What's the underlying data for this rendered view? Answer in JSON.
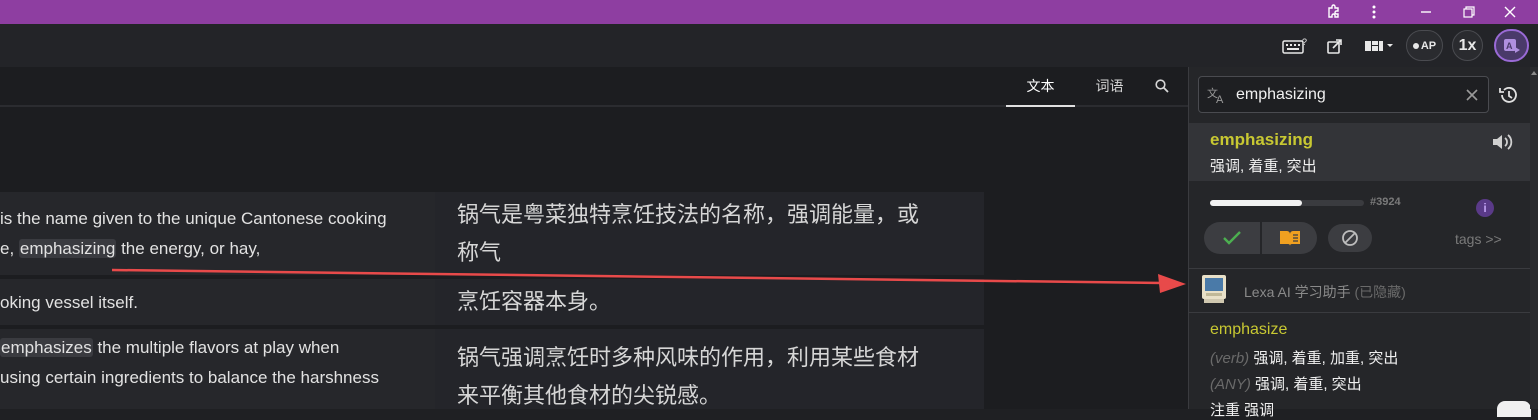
{
  "toolbar": {
    "ap_label": "AP",
    "speed_label": "1x"
  },
  "tabs": [
    {
      "label": "文本"
    },
    {
      "label": "词语"
    }
  ],
  "rows": [
    {
      "source_lines": [
        {
          "pre": " is the name given to the unique Cantonese cooking",
          "hl": "",
          "post": ""
        },
        {
          "pre": "e, ",
          "hl": "emphasizing",
          "post": " the energy, or hay,"
        }
      ],
      "target": "锅气是粤菜独特烹饪技法的名称，强调能量，或称气"
    },
    {
      "source_lines": [
        {
          "pre": "oking vessel itself.",
          "hl": "",
          "post": ""
        }
      ],
      "target": "烹饪容器本身。"
    },
    {
      "source_lines": [
        {
          "pre": " ",
          "hl": "emphasizes",
          "post": " the multiple flavors at play when"
        },
        {
          "pre": " using certain ingredients to balance the harshness",
          "hl": "",
          "post": ""
        }
      ],
      "target": "锅气强调烹饪时多种风味的作用，利用某些食材来平衡其他食材的尖锐感。"
    }
  ],
  "sidebar": {
    "search_value": "emphasizing",
    "entry": {
      "word": "emphasizing",
      "translation": "强调, 着重, 突出"
    },
    "frequency": "#3924",
    "frequency_fill": 0.6,
    "tags_link": "tags >>",
    "assistant": {
      "name": "Lexa AI 学习助手",
      "status": "(已隐藏)"
    },
    "dictionary": {
      "lemma": "emphasize",
      "senses": [
        {
          "pos": "(verb)",
          "meaning": "强调, 着重, 加重, 突出"
        },
        {
          "pos": "(ANY)",
          "meaning": "强调, 着重, 突出"
        }
      ],
      "partial_line": "注重 强调"
    }
  },
  "colors": {
    "title_bar": "#8e3ea1",
    "accent_yellow": "#c8c832",
    "arrow": "#e84a4a",
    "check_green": "#4caf50",
    "book_orange": "#f0a020"
  }
}
